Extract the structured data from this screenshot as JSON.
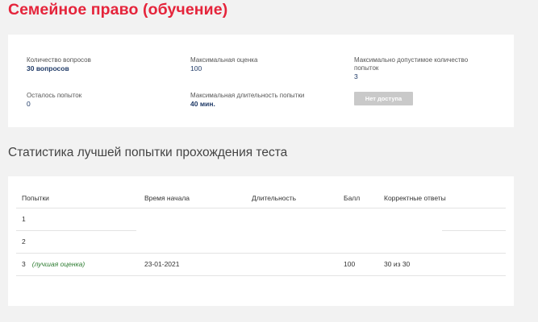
{
  "page": {
    "title": "Семейное право (обучение)"
  },
  "info": {
    "questions_label": "Количество вопросов",
    "questions_value": "30 вопросов",
    "max_score_label": "Максимальная оценка",
    "max_score_value": "100",
    "max_attempts_label": "Максимально допустимое количество попыток",
    "max_attempts_value": "3",
    "remaining_label": "Осталось попыток",
    "remaining_value": "0",
    "max_duration_label": "Максимальная длительность попытки",
    "max_duration_value": "40 мин.",
    "no_access_label": "Нет доступа"
  },
  "stats": {
    "title": "Статистика лучшей попытки прохождения теста",
    "columns": {
      "attempts": "Попытки",
      "start_time": "Время начала",
      "duration": "Длительность",
      "score": "Балл",
      "correct": "Корректные ответы"
    },
    "rows": [
      {
        "attempt": "1",
        "note": "",
        "start_time": "",
        "duration": "",
        "score": "",
        "correct": ""
      },
      {
        "attempt": "2",
        "note": "",
        "start_time": "",
        "duration": "",
        "score": "",
        "correct": ""
      },
      {
        "attempt": "3",
        "note": "(лучшая оценка)",
        "start_time": "23-01-2021",
        "duration": "",
        "score": "100",
        "correct": "30 из 30"
      }
    ]
  },
  "colors": {
    "title_red": "#e5243b",
    "value_blue": "#1f3a67",
    "best_green": "#2e7d32",
    "button_gray": "#c9c9c9"
  }
}
